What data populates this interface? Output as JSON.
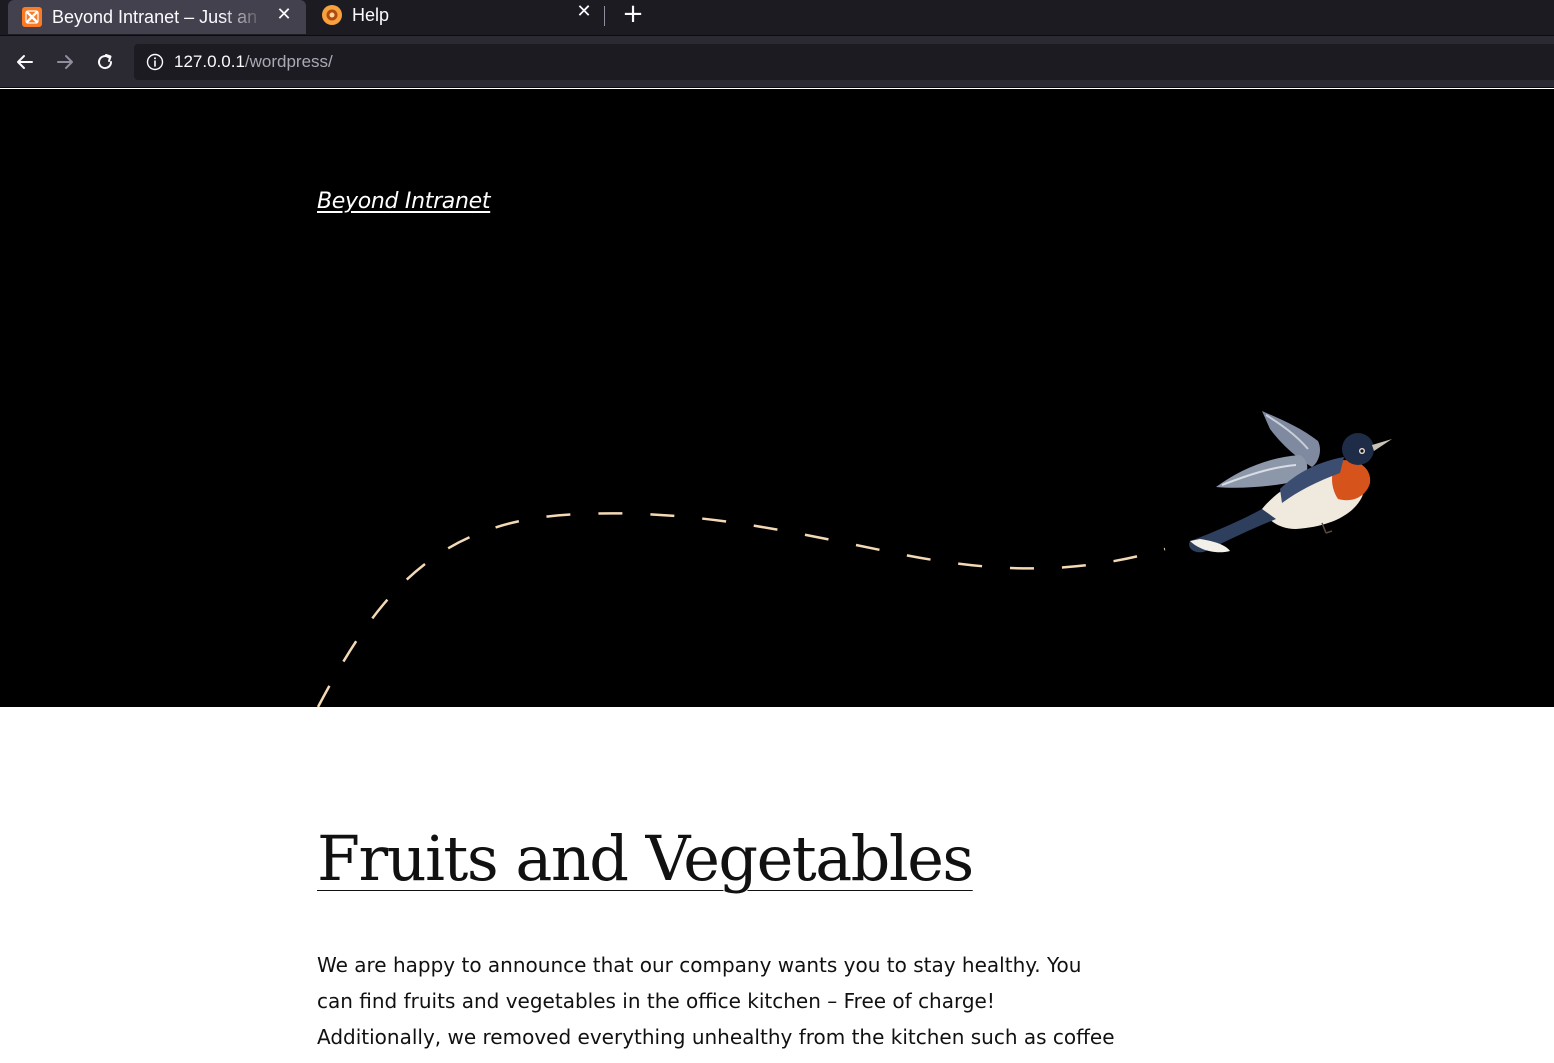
{
  "browser": {
    "tabs": [
      {
        "label": "Beyond Intranet – Just an",
        "icon": "xampp-icon",
        "active": true
      },
      {
        "label": "Help",
        "icon": "help-icon",
        "active": false
      }
    ],
    "url": {
      "host": "127.0.0.1",
      "path": "/wordpress/"
    }
  },
  "site": {
    "title": "Beyond Intranet"
  },
  "post": {
    "title": "Fruits and Vegetables",
    "body": "We are happy to announce that our company wants you to stay healthy. You can find fruits and vegetables in the office kitchen – Free of charge! Additionally, we removed everything unhealthy from the kitchen such as coffee and sugar. Let us"
  },
  "colors": {
    "hero_bg": "#000000",
    "flight_path": "#f4d9b5",
    "tab_active_bg": "#42414d",
    "chrome_bg": "#1c1b22"
  }
}
